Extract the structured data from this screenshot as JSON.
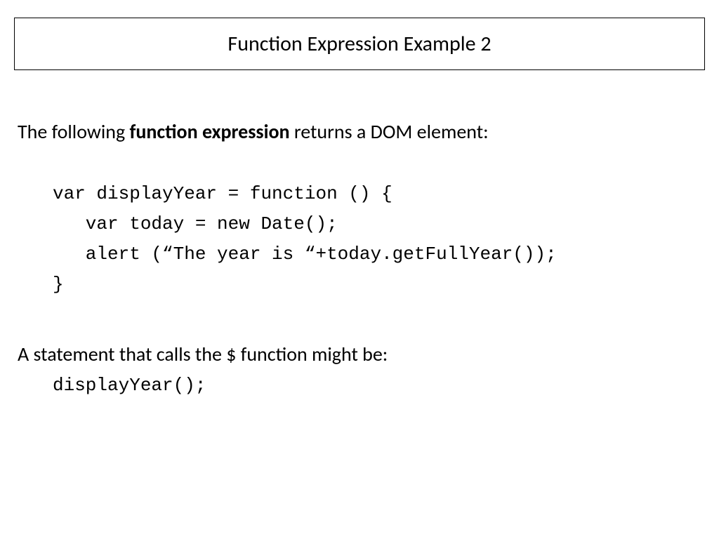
{
  "title": "Function Expression Example 2",
  "intro_prefix": "The following ",
  "intro_bold": "function expression",
  "intro_suffix": " returns a DOM element:",
  "code_line1": "var displayYear = function () {",
  "code_line2": "   var today = new Date();",
  "code_line3": "   alert (“The year is “+today.getFullYear());",
  "code_line4": "}",
  "statement": "A statement that calls the $ function might be:",
  "call": "displayYear();"
}
